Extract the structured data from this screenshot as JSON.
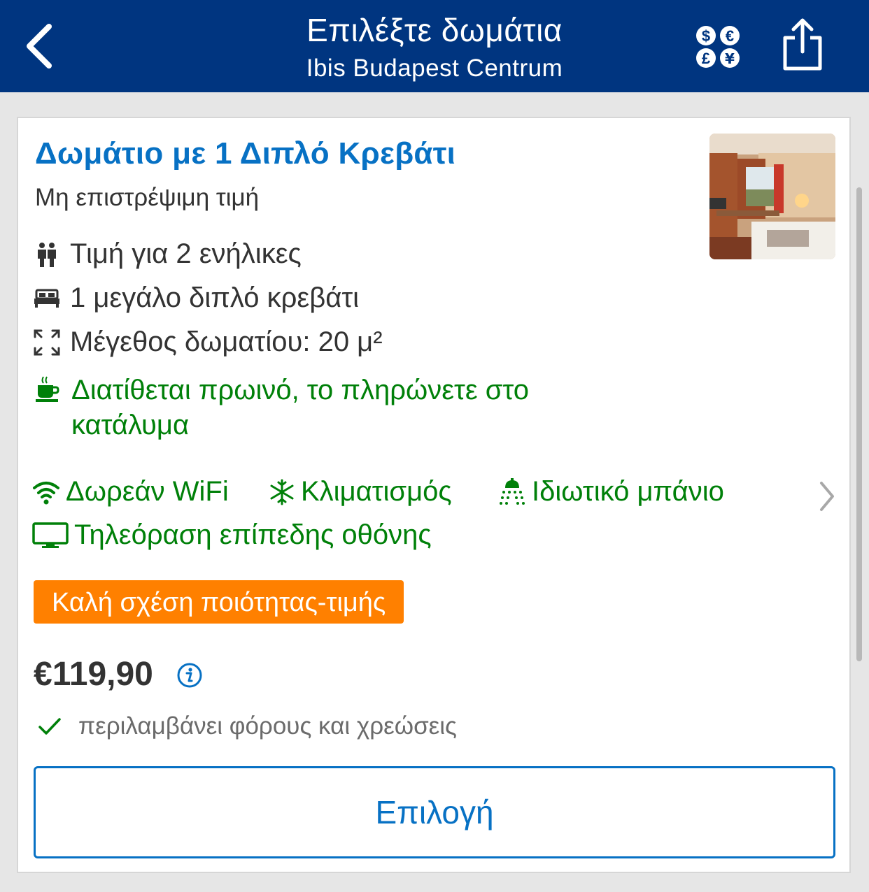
{
  "header": {
    "title": "Επιλέξτε δωμάτια",
    "subtitle": "Ibis Budapest Centrum",
    "back_icon": "chevron-left-icon",
    "currency_icon": "currency-icon",
    "share_icon": "share-icon"
  },
  "room": {
    "title": "Δωμάτιο με 1 Διπλό Κρεβάτι",
    "rate_type": "Μη επιστρέψιμη τιμή",
    "occupancy": "Τιμή για 2 ενήλικες",
    "bed": "1 μεγάλο διπλό κρεβάτι",
    "size": "Μέγεθος δωματίου: 20 μ²",
    "breakfast": "Διατίθεται πρωινό, το πληρώνετε στο κατάλυμα"
  },
  "facilities": [
    {
      "label": "Δωρεάν WiFi",
      "icon": "wifi-icon"
    },
    {
      "label": "Κλιματισμός",
      "icon": "snowflake-icon"
    },
    {
      "label": "Ιδιωτικό μπάνιο",
      "icon": "shower-icon"
    },
    {
      "label": "Τηλεόραση επίπεδης οθόνης",
      "icon": "tv-icon"
    }
  ],
  "badge": "Καλή σχέση ποιότητας-τιμής",
  "price": "€119,90",
  "taxes_note": "περιλαμβάνει φόρους και χρεώσεις",
  "select_label": "Επιλογή",
  "colors": {
    "header_bg": "#003580",
    "link_blue": "#0771c4",
    "green": "#008009",
    "badge_orange": "#ff8000"
  }
}
